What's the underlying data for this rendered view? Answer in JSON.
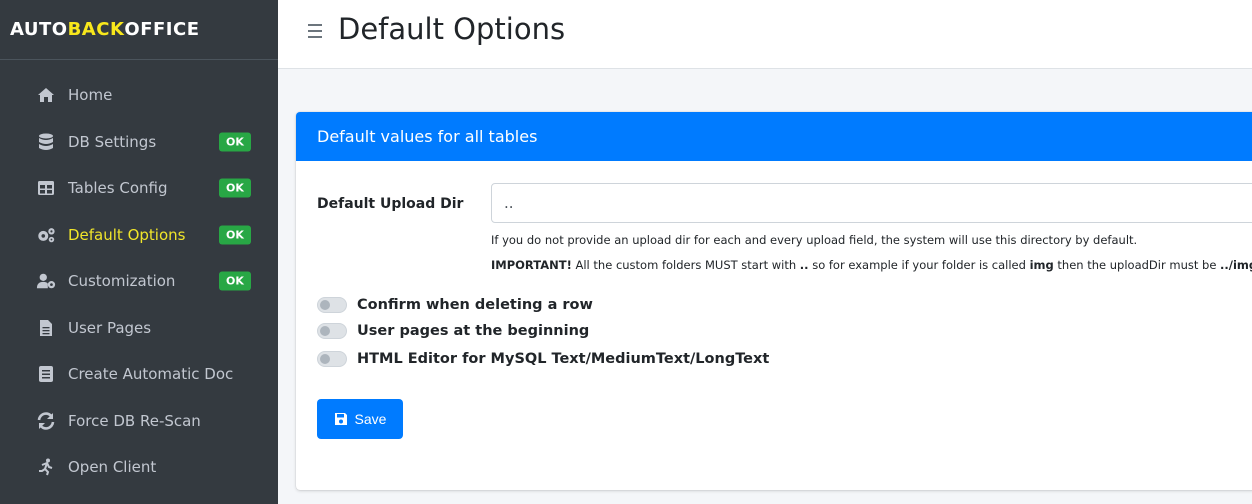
{
  "brand": {
    "part1": "AUTO",
    "part2": "BACK",
    "part3": "O",
    "part4": "FFICE"
  },
  "header": {
    "title": "Default Options"
  },
  "sidebar": {
    "items": [
      {
        "label": "Home",
        "icon": "home-icon",
        "badge": ""
      },
      {
        "label": "DB Settings",
        "icon": "database-icon",
        "badge": "OK"
      },
      {
        "label": "Tables Config",
        "icon": "table-icon",
        "badge": "OK"
      },
      {
        "label": "Default Options",
        "icon": "cogs-icon",
        "badge": "OK",
        "active": true
      },
      {
        "label": "Customization",
        "icon": "user-cog-icon",
        "badge": "OK"
      },
      {
        "label": "User Pages",
        "icon": "file-icon",
        "badge": ""
      },
      {
        "label": "Create Automatic Doc",
        "icon": "document-icon",
        "badge": ""
      },
      {
        "label": "Force DB Re-Scan",
        "icon": "sync-icon",
        "badge": ""
      },
      {
        "label": "Open Client",
        "icon": "running-icon",
        "badge": ""
      }
    ]
  },
  "card": {
    "title": "Default values for all tables",
    "upload_label": "Default Upload Dir",
    "upload_value": "..",
    "help1": "If you do not provide an upload dir for each and every upload field, the system will use this directory by default.",
    "help2_bold1": "IMPORTANT!",
    "help2_text1": " All the custom folders MUST start with ",
    "help2_bold2": "..",
    "help2_text2": " so for example if your folder is called ",
    "help2_bold3": "img",
    "help2_text3": " then the uploadDir must be ",
    "help2_bold4": "../img",
    "toggles": [
      {
        "label": "Confirm when deleting a row",
        "on": false
      },
      {
        "label": "User pages at the beginning",
        "on": false
      },
      {
        "label": "HTML Editor for MySQL Text/MediumText/LongText",
        "on": false
      }
    ],
    "save_label": "Save"
  },
  "colors": {
    "sidebar_bg": "#343a40",
    "accent": "#007bff",
    "badge": "#28a745",
    "active_text": "#f0e52a"
  }
}
